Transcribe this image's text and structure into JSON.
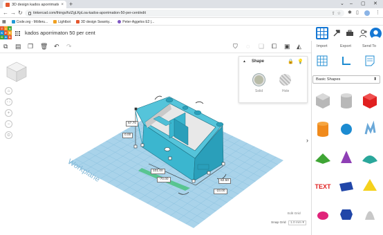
{
  "browser": {
    "tab_title": "3D design kados aporrimation 50...",
    "tab_close": "×",
    "new_tab": "+",
    "window_controls": [
      "⌄",
      "–",
      "▢",
      "✕"
    ],
    "url": "tinkercad.com/things/fuIZgLKpLoa-kados-aporrimation-50-per-cent/edit",
    "bookmarks": [
      {
        "label": "Code.org - Mölleru...",
        "color": "#1f9ad6"
      },
      {
        "label": "Lightbot",
        "color": "#f0a020"
      },
      {
        "label": "3D design Swanky...",
        "color": "#e4572e"
      },
      {
        "label": "Peter-Aggelos E2 |...",
        "color": "#7e57c2"
      }
    ]
  },
  "app": {
    "logo_letters": [
      "T",
      "I",
      "N",
      "K",
      "E",
      "R",
      "C",
      "A",
      "D"
    ],
    "logo_colors": [
      "#e4572e",
      "#f4a524",
      "#3fa535",
      "#1c8bd1",
      "#e4572e",
      "#f4a524",
      "#3fa535",
      "#1c8bd1",
      "#e4572e"
    ],
    "project_title": "kados aporrimaton 50 per cent",
    "import_label": "Import",
    "export_label": "Export",
    "send_to_label": "Send To"
  },
  "shape_panel": {
    "title": "Shape",
    "solid_label": "Solid",
    "hole_label": "Hole"
  },
  "library": {
    "category": "Basic Shapes",
    "shapes": [
      {
        "name": "box-hole",
        "color": "#b8b8b8"
      },
      {
        "name": "cylinder-hole",
        "color": "#b8b8b8"
      },
      {
        "name": "box",
        "color": "#e02020"
      },
      {
        "name": "cylinder",
        "color": "#f08a1c"
      },
      {
        "name": "sphere",
        "color": "#1c8bd1"
      },
      {
        "name": "scribble",
        "color": "#6aa8d8"
      },
      {
        "name": "roof",
        "color": "#3fa535"
      },
      {
        "name": "cone",
        "color": "#8e3fb5"
      },
      {
        "name": "round-roof",
        "color": "#2aa79b"
      },
      {
        "name": "text",
        "color": "#e02020"
      },
      {
        "name": "wedge",
        "color": "#2146a8"
      },
      {
        "name": "pyramid",
        "color": "#f5d11c"
      },
      {
        "name": "half-sphere",
        "color": "#e0247a"
      },
      {
        "name": "polygon",
        "color": "#2146a8"
      },
      {
        "name": "paraboloid",
        "color": "#c8c8c8"
      }
    ]
  },
  "dimensions": {
    "height": "67.70",
    "elevation": "0.00",
    "length": "101.00",
    "width_offset": "-70.00",
    "width": "62.50",
    "depth_offset": "-23.00"
  },
  "workplane": {
    "label": "Workplane",
    "edit_grid": "Edit Grid",
    "snap_grid_label": "Snap Grid",
    "snap_grid_value": "1.0 mm ▾"
  },
  "colors": {
    "accent": "#1477d4",
    "model_fill": "#3bb0c9",
    "workplane": "#a9d3ea"
  }
}
